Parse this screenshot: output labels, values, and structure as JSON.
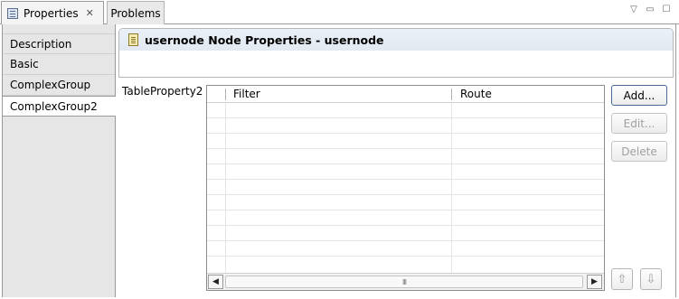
{
  "tabs": [
    {
      "label": "Properties",
      "active": true
    },
    {
      "label": "Problems",
      "active": false
    }
  ],
  "view_controls": [
    "view-menu-icon",
    "minimize-icon",
    "maximize-icon"
  ],
  "categories": [
    {
      "label": "Description"
    },
    {
      "label": "Basic"
    },
    {
      "label": "ComplexGroup"
    },
    {
      "label": "ComplexGroup2",
      "selected": true
    }
  ],
  "header": {
    "title": "usernode Node Properties - usernode"
  },
  "property": {
    "label": "TableProperty2"
  },
  "table": {
    "columns": [
      "",
      "Filter",
      "Route"
    ],
    "rows": [],
    "scroll_mark": "III"
  },
  "buttons": {
    "add": "Add...",
    "edit": "Edit...",
    "delete": "Delete",
    "move_up": "⇧",
    "move_down": "⇩"
  },
  "colors": {
    "header_bg": "#e6ecf4",
    "left_pane_bg": "#e6e6e6",
    "disabled_text": "#a0a0a0"
  }
}
